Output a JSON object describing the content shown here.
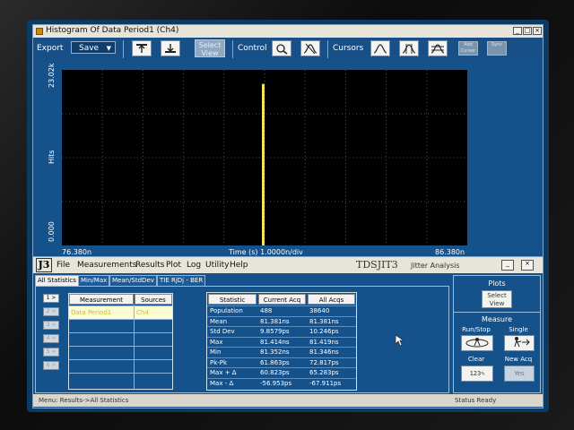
{
  "window1": {
    "title": "Histogram Of Data Period1 (Ch4)",
    "minimize": "_",
    "maximize": "□",
    "close": "×",
    "toolbar": {
      "export_label": "Export",
      "save_label": "Save",
      "select_view_line1": "Select",
      "select_view_line2": "View",
      "control_label": "Control",
      "cursors_label": "Cursors",
      "dim_button_1": "Add Cursor",
      "dim_button_2": "Sync"
    },
    "plot": {
      "y_axis_label": "Hits",
      "y_top": "23.02k",
      "y_bottom": "0.000",
      "x_left": "76.380n",
      "x_right": "86.380n",
      "x_center": "Time (s)   1.0000n/div",
      "bar_color": "#f5e15a",
      "peak_fraction": 0.92
    }
  },
  "window2": {
    "menu": [
      "File",
      "Measurements",
      "Results",
      "Plot",
      "Log",
      "Utility",
      "Help"
    ],
    "logo": "J3",
    "brand": "TDSJIT3",
    "brand_sub": "Jitter Analysis",
    "minimize": "_",
    "close": "×",
    "tabs": [
      "All Statistics",
      "Min/Max",
      "Mean/StdDev",
      "TIE RjDj - BER"
    ],
    "measurement_table": {
      "headers": [
        "Measurement",
        "Sources"
      ],
      "rows": [
        {
          "measurement": "Data Period1",
          "source": "Ch4"
        }
      ],
      "index_buttons": [
        "1 >",
        "2 >",
        "3 >",
        "4 >",
        "5 >",
        "6 >"
      ]
    },
    "stats_table": {
      "headers": [
        "Statistic",
        "Current Acq",
        "All Acqs"
      ],
      "rows": [
        [
          "Population",
          "488",
          "38640"
        ],
        [
          "Mean",
          "81.381ns",
          "81.381ns"
        ],
        [
          "Std Dev",
          "9.8579ps",
          "10.246ps"
        ],
        [
          "Max",
          "81.414ns",
          "81.419ns"
        ],
        [
          "Min",
          "81.352ns",
          "81.346ns"
        ],
        [
          "Pk-Pk",
          "61.863ps",
          "72.817ps"
        ],
        [
          "Max + Δ",
          "60.823ps",
          "65.283ps"
        ],
        [
          "Max - Δ",
          "-56.953ps",
          "-67.911ps"
        ]
      ]
    },
    "right_panel": {
      "plots_label": "Plots",
      "select_view": "Select View",
      "measure_label": "Measure",
      "run_stop_label": "Run/Stop",
      "single_label": "Single",
      "clear_label": "Clear",
      "clear_value": "123",
      "new_acq_label": "New Acq",
      "new_acq_value": "Yes"
    },
    "status": {
      "menu_path": "Menu: Results->All Statistics",
      "status_text": "Status    Ready"
    }
  }
}
